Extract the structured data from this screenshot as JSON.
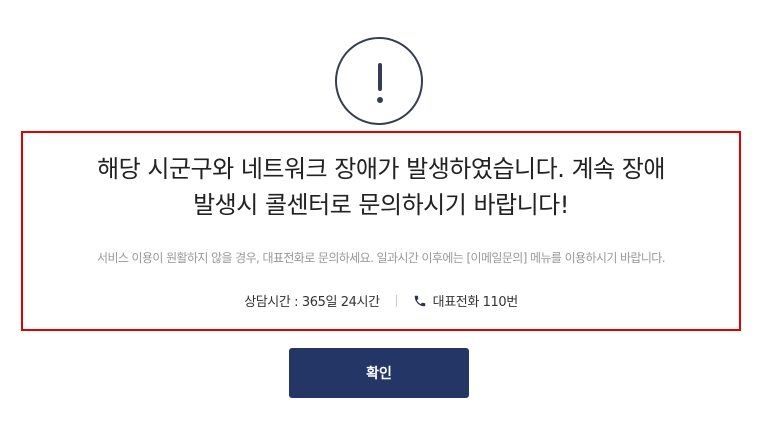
{
  "icon": "exclamation-circle-icon",
  "notice": {
    "title_line1": "해당 시군구와 네트워크 장애가 발생하였습니다. 계속 장애",
    "title_line2": "발생시 콜센터로 문의하시기 바랍니다!",
    "guide_text": "서비스 이용이 원활하지 않을 경우, 대표전화로 문의하세요. 일과시간 이후에는 [이메일문의] 메뉴를 이용하시기 바랍니다.",
    "hours_text": "상담시간 : 365일 24시간",
    "phone_icon": "phone-icon",
    "phone_text": "대표전화 110번"
  },
  "confirm_button": {
    "label": "확인"
  },
  "colors": {
    "icon": "#363d52",
    "highlight_border": "#e00000",
    "button": "#233665"
  }
}
